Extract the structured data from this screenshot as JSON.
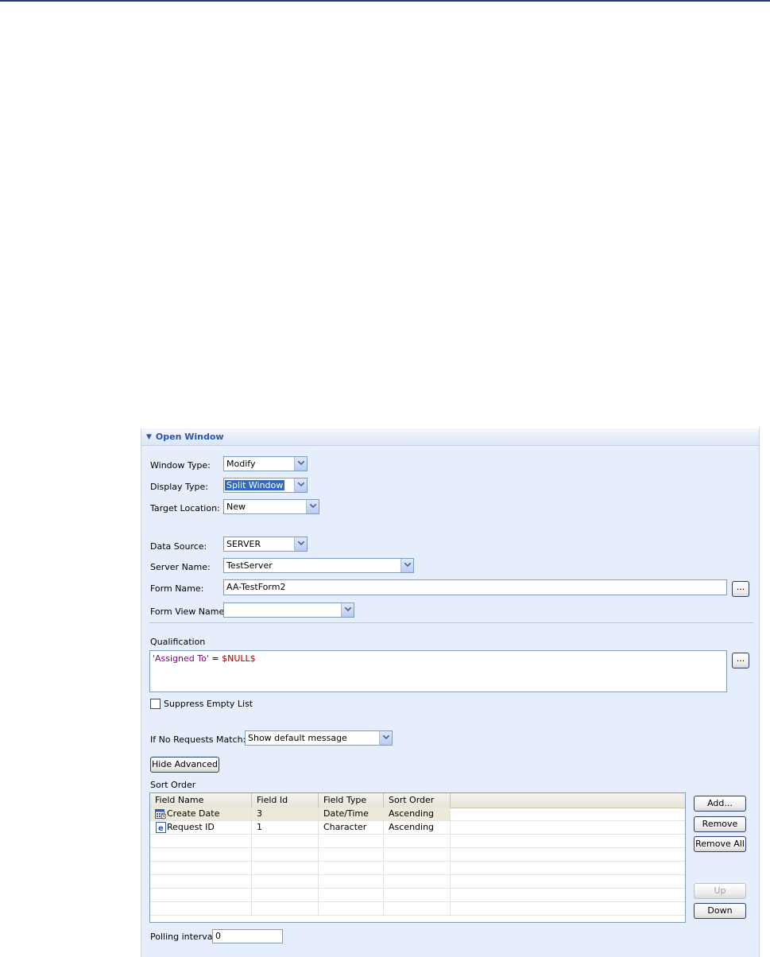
{
  "panel": {
    "title": "Open Window"
  },
  "form": {
    "window_type": {
      "label": "Window Type:",
      "value": "Modify"
    },
    "display_type": {
      "label": "Display Type:",
      "value": "Split Window"
    },
    "target_location": {
      "label": "Target Location:",
      "value": "New"
    },
    "data_source": {
      "label": "Data Source:",
      "value": "SERVER"
    },
    "server_name": {
      "label": "Server Name:",
      "value": "TestServer"
    },
    "form_name": {
      "label": "Form Name:",
      "value": "AA-TestForm2",
      "browse_label": "..."
    },
    "form_view_name": {
      "label": "Form View Name:",
      "value": ""
    }
  },
  "qualification": {
    "label": "Qualification",
    "string_part": "'Assigned To'",
    "operator_part": " = ",
    "keyword_part": "$NULL$",
    "browse_label": "..."
  },
  "suppress_empty_list": {
    "label": "Suppress Empty List",
    "checked": false
  },
  "no_requests_match": {
    "label": "If No Requests Match:",
    "value": "Show default message"
  },
  "hide_advanced_label": "Hide Advanced",
  "sort_order": {
    "label": "Sort Order",
    "columns": [
      "Field Name",
      "Field Id",
      "Field Type",
      "Sort Order"
    ],
    "rows": [
      {
        "icon": "date-field-icon",
        "field_name": "Create Date",
        "field_id": "3",
        "field_type": "Date/Time",
        "sort_order": "Ascending"
      },
      {
        "icon": "character-field-icon",
        "field_name": "Request ID",
        "field_id": "1",
        "field_type": "Character",
        "sort_order": "Ascending"
      }
    ],
    "buttons": {
      "add": "Add...",
      "remove": "Remove",
      "remove_all": "Remove All",
      "up": "Up",
      "down": "Down"
    }
  },
  "polling_interval": {
    "label": "Polling interval",
    "value": "0"
  }
}
